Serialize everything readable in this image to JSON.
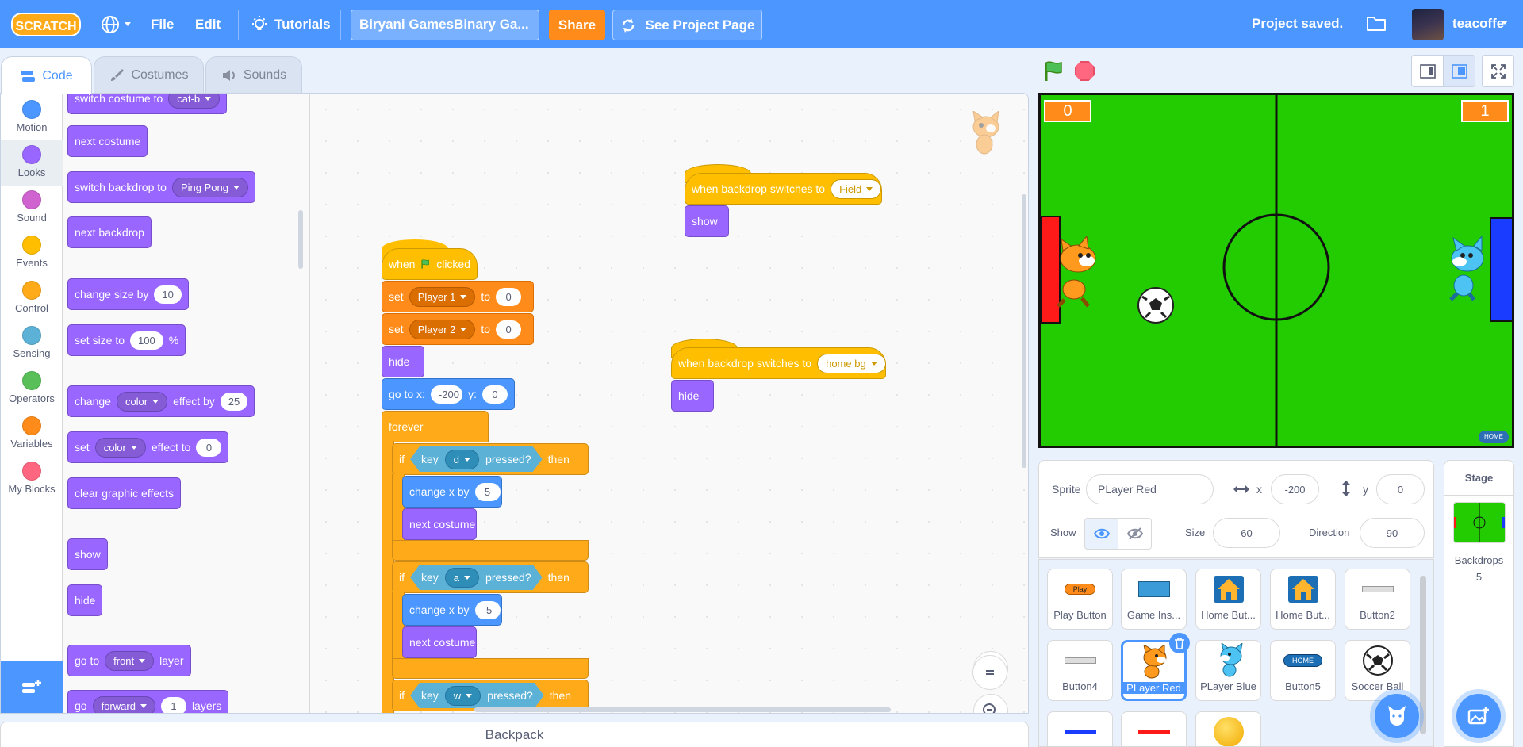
{
  "menu": {
    "logo": "SCRATCH",
    "file": "File",
    "edit": "Edit",
    "tutorials": "Tutorials",
    "project_title": "Biryani GamesBinary Ga...",
    "share": "Share",
    "see_project_page": "See Project Page",
    "status": "Project saved.",
    "username": "teacoffe"
  },
  "tabs": {
    "code": "Code",
    "costumes": "Costumes",
    "sounds": "Sounds"
  },
  "categories": [
    {
      "label": "Motion",
      "color": "#4c97ff"
    },
    {
      "label": "Looks",
      "color": "#9966ff"
    },
    {
      "label": "Sound",
      "color": "#cf63cf"
    },
    {
      "label": "Events",
      "color": "#ffbf00"
    },
    {
      "label": "Control",
      "color": "#ffab19"
    },
    {
      "label": "Sensing",
      "color": "#5cb1d6"
    },
    {
      "label": "Operators",
      "color": "#59c059"
    },
    {
      "label": "Variables",
      "color": "#ff8c1a"
    },
    {
      "label": "My Blocks",
      "color": "#ff6680"
    }
  ],
  "palette": {
    "switch_costume": "switch costume to",
    "costume_value": "cat-b",
    "next_costume": "next costume",
    "switch_backdrop": "switch backdrop to",
    "backdrop_value": "Ping Pong",
    "next_backdrop": "next backdrop",
    "change_size": "change size by",
    "change_size_value": "10",
    "set_size": "set size to",
    "set_size_value": "100",
    "percent": "%",
    "change_effect": "change",
    "effect_name": "color",
    "effect_by": "effect by",
    "effect_by_value": "25",
    "set_effect": "set",
    "set_effect_name": "color",
    "effect_to": "effect to",
    "effect_to_value": "0",
    "clear_effects": "clear graphic effects",
    "show": "show",
    "hide": "hide",
    "go_to": "go to",
    "layer_value": "front",
    "layer": "layer",
    "go": "go",
    "direction_value": "forward",
    "layers_value": "1",
    "layers": "layers"
  },
  "script_main": {
    "when": "when",
    "clicked": "clicked",
    "set": "set",
    "var1": "Player 1",
    "to": "to",
    "val1": "0",
    "var2": "Player 2",
    "val2": "0",
    "hide": "hide",
    "goto_x": "go to x:",
    "x_val": "-200",
    "y": "y:",
    "y_val": "0",
    "forever": "forever",
    "if": "if",
    "then": "then",
    "key": "key",
    "pressed": "pressed?",
    "key1": "d",
    "change_x": "change x by",
    "dx1": "5",
    "next_costume": "next costume",
    "key2": "a",
    "dx2": "-5",
    "key3": "w"
  },
  "script_field": {
    "when_backdrop": "when backdrop switches to",
    "backdrop": "Field",
    "action": "show"
  },
  "script_home": {
    "when_backdrop": "when backdrop switches to",
    "backdrop": "home bg",
    "action": "hide"
  },
  "backpack": "Backpack",
  "stage": {
    "score_left": "0",
    "score_right": "1",
    "home_button": "HOME"
  },
  "sprite_info": {
    "sprite_label": "Sprite",
    "sprite_name": "PLayer Red",
    "x_label": "x",
    "x": "-200",
    "y_label": "y",
    "y": "0",
    "show_label": "Show",
    "size_label": "Size",
    "size": "60",
    "direction_label": "Direction",
    "direction": "90"
  },
  "sprites": [
    {
      "name": "Play Button",
      "thumb_text": "Play"
    },
    {
      "name": "Game Ins...",
      "thumb_text": ""
    },
    {
      "name": "Home But...",
      "thumb_text": ""
    },
    {
      "name": "Home But...",
      "thumb_text": ""
    },
    {
      "name": "Button2",
      "thumb_text": ""
    },
    {
      "name": "Button4",
      "thumb_text": ""
    },
    {
      "name": "PLayer Red",
      "thumb_text": ""
    },
    {
      "name": "PLayer Blue",
      "thumb_text": ""
    },
    {
      "name": "Button5",
      "thumb_text": "HOME"
    },
    {
      "name": "Soccer Ball",
      "thumb_text": ""
    }
  ],
  "stage_pane": {
    "title": "Stage",
    "backdrops_label": "Backdrops",
    "backdrops_count": "5"
  }
}
